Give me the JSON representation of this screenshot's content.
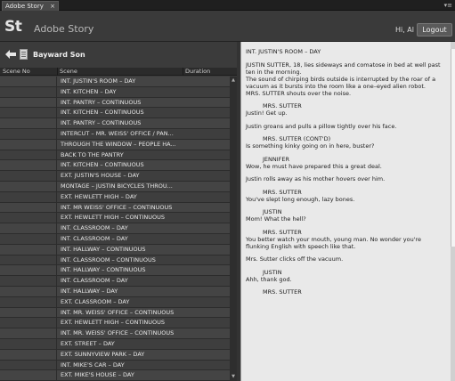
{
  "tab": {
    "label": "Adobe Story",
    "close": "×"
  },
  "panel_menu": "▾≡",
  "header": {
    "logo": "St",
    "app_name": "Adobe Story",
    "greeting": "Hi, Al",
    "logout": "Logout"
  },
  "project": {
    "title": "Bayward Son"
  },
  "columns": {
    "scene_no": "Scene No",
    "scene": "Scene",
    "duration": "Duration"
  },
  "scenes": [
    "INT. JUSTIN'S ROOM – DAY",
    "INT. KITCHEN – DAY",
    "INT. PANTRY – CONTINUOUS",
    "INT. KITCHEN – CONTINUOUS",
    "INT. PANTRY – CONTINUOUS",
    "INTERCUT – MR. WEISS' OFFICE / PAN...",
    "THROUGH THE WINDOW – PEOPLE HA...",
    "BACK TO THE PANTRY",
    "INT. KITCHEN – CONTINUOUS",
    "EXT. JUSTIN'S HOUSE – DAY",
    "MONTAGE – JUSTIN BICYCLES THROU...",
    "EXT. HEWLETT HIGH – DAY",
    "INT. MR WEISS' OFFICE – CONTINUOUS",
    "EXT. HEWLETT HIGH – CONTINUOUS",
    "INT. CLASSROOM – DAY",
    "INT. CLASSROOM – DAY",
    "INT. HALLWAY – CONTINUOUS",
    "INT. CLASSROOM – CONTINUOUS",
    "INT. HALLWAY – CONTINUOUS",
    "INT. CLASSROOM – DAY",
    "INT. HALLWAY – DAY",
    "EXT. CLASSROOM – DAY",
    "INT. MR. WEISS' OFFICE – CONTINUOUS",
    "EXT. HEWLETT HIGH – CONTINUOUS",
    "INT. MR. WEISS' OFFICE – CONTINUOUS",
    "EXT. STREET – DAY",
    "EXT. SUNNYVIEW PARK – DAY",
    "INT. MIKE'S CAR – DAY",
    "EXT. MIKE'S HOUSE – DAY"
  ],
  "script_lines": [
    {
      "type": "scene",
      "text": "INT. JUSTIN'S ROOM – DAY"
    },
    {
      "type": "action",
      "text": "JUSTIN SUTTER, 18, lies sideways and comatose in bed at well past"
    },
    {
      "type": "action",
      "text": "ten in the morning."
    },
    {
      "type": "action",
      "text": "The sound of chirping birds outside is interrupted by the roar of a"
    },
    {
      "type": "action",
      "text": "vacuum as it bursts into the room like a one–eyed alien robot."
    },
    {
      "type": "action",
      "text": "MRS. SUTTER shouts over the noise."
    },
    {
      "type": "character",
      "text": "MRS. SUTTER"
    },
    {
      "type": "dialogue",
      "text": "Justin!  Get up."
    },
    {
      "type": "action",
      "text": "Justin groans and pulls a pillow tightly over his face."
    },
    {
      "type": "character",
      "text": "MRS. SUTTER (CONT'D)"
    },
    {
      "type": "dialogue",
      "text": "Is something kinky going on in here, buster?"
    },
    {
      "type": "character",
      "text": "JENNIFER"
    },
    {
      "type": "dialogue",
      "text": "Wow, he must have prepared this a great deal."
    },
    {
      "type": "action",
      "text": "Justin rolls away as his mother hovers over him."
    },
    {
      "type": "character",
      "text": "MRS. SUTTER"
    },
    {
      "type": "dialogue",
      "text": "You've slept long enough, lazy bones."
    },
    {
      "type": "character",
      "text": "JUSTIN"
    },
    {
      "type": "dialogue",
      "text": "Mom!  What the hell?"
    },
    {
      "type": "character",
      "text": "MRS. SUTTER"
    },
    {
      "type": "dialogue",
      "text": "You better watch your mouth, young man.  No wonder you're"
    },
    {
      "type": "dialogue",
      "text": "flunking English with speech like that."
    },
    {
      "type": "action",
      "text": "Mrs. Sutter clicks off the vacuum."
    },
    {
      "type": "character",
      "text": "JUSTIN"
    },
    {
      "type": "dialogue",
      "text": "Ahh, thank god."
    },
    {
      "type": "character",
      "text": "MRS. SUTTER"
    }
  ],
  "colors": {
    "panel_dark": "#3b3b3b",
    "row_alt": "#444444",
    "script_bg": "#e9e9e9"
  },
  "icons": {
    "back": "back-arrow-icon",
    "document": "document-icon"
  }
}
